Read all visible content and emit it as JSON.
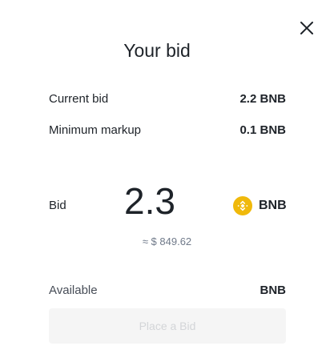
{
  "modal": {
    "title": "Your bid",
    "close_icon": "close-icon"
  },
  "details": {
    "current_bid": {
      "label": "Current bid",
      "value": "2.2 BNB"
    },
    "minimum_markup": {
      "label": "Minimum markup",
      "value": "0.1 BNB"
    }
  },
  "bid": {
    "label": "Bid",
    "amount": "2.3",
    "currency": "BNB",
    "currency_icon": "bnb-icon",
    "usd_estimate": "≈ $ 849.62"
  },
  "available": {
    "label": "Available",
    "value": "BNB"
  },
  "actions": {
    "place_bid_label": "Place a Bid",
    "place_bid_enabled": false
  },
  "colors": {
    "text_primary": "#1e2329",
    "text_secondary": "#707a8a",
    "bnb_yellow": "#f0b90b",
    "button_disabled_bg": "#f5f5f5",
    "button_disabled_text": "#d3d5d8"
  }
}
